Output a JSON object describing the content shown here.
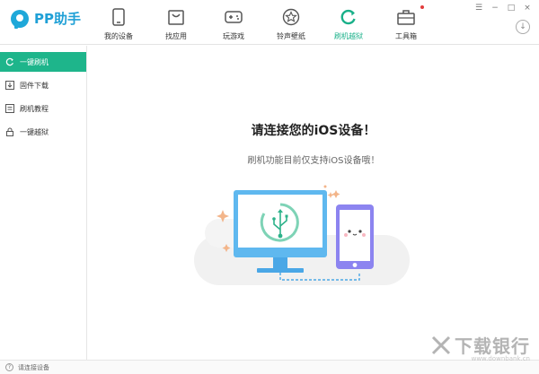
{
  "app": {
    "title": "PP助手"
  },
  "nav": {
    "items": [
      {
        "label": "我的设备",
        "icon": "phone-icon"
      },
      {
        "label": "找应用",
        "icon": "bag-icon"
      },
      {
        "label": "玩游戏",
        "icon": "gamepad-icon"
      },
      {
        "label": "铃声壁纸",
        "icon": "star-icon"
      },
      {
        "label": "刷机越狱",
        "icon": "refresh-icon",
        "active": true
      },
      {
        "label": "工具箱",
        "icon": "toolbox-icon",
        "badge": true
      }
    ]
  },
  "window": {
    "menu": "☰",
    "minimize": "−",
    "maximize": "□",
    "close": "×",
    "download": "↓"
  },
  "sidebar": {
    "items": [
      {
        "label": "一键刷机",
        "icon": "refresh-icon",
        "active": true
      },
      {
        "label": "固件下载",
        "icon": "download-icon"
      },
      {
        "label": "刷机教程",
        "icon": "book-icon"
      },
      {
        "label": "一键越狱",
        "icon": "lock-icon"
      }
    ]
  },
  "main": {
    "title": "请连接您的iOS设备！",
    "subtitle": "刷机功能目前仅支持iOS设备哦！"
  },
  "status": {
    "text": "请连接设备",
    "icon": "?"
  },
  "watermark": {
    "text": "下载银行",
    "sub": "www.downbank.cn"
  },
  "colors": {
    "accent": "#1eb58b",
    "brand": "#1fa0d6",
    "monitor": "#5fb8ef",
    "phone": "#8c84f0"
  }
}
